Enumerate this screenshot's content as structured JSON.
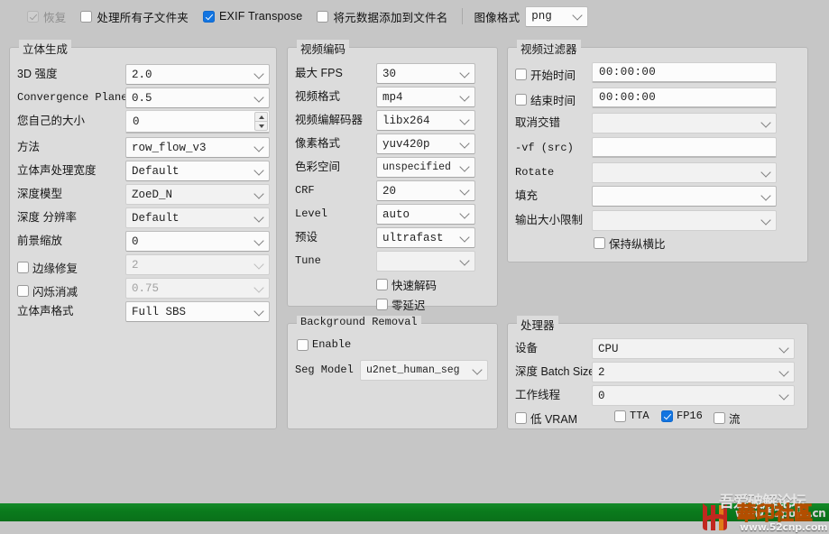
{
  "toolbar": {
    "restore": {
      "label": "恢复",
      "checked": true,
      "disabled": true
    },
    "process_subfolders": {
      "label": "处理所有子文件夹",
      "checked": false
    },
    "exif_transpose": {
      "label": "EXIF Transpose",
      "checked": true
    },
    "add_metadata_to_filename": {
      "label": "将元数据添加到文件名",
      "checked": false
    },
    "image_format_label": "图像格式",
    "image_format_value": "png"
  },
  "stereo_generation": {
    "title": "立体生成",
    "rows": [
      {
        "label": "3D 强度",
        "value": "2.0",
        "type": "combo"
      },
      {
        "label": "Convergence Plane",
        "value": "0.5",
        "type": "combo"
      },
      {
        "label": "您自己的大小",
        "value": "0",
        "type": "spin"
      },
      {
        "label": "方法",
        "value": "row_flow_v3",
        "type": "combo"
      },
      {
        "label": "立体声处理宽度",
        "value": "Default",
        "type": "combo"
      },
      {
        "label": "深度模型",
        "value": "ZoeD_N",
        "type": "combo"
      },
      {
        "label": "深度 分辨率",
        "value": "Default",
        "type": "combo"
      },
      {
        "label": "前景缩放",
        "value": "0",
        "type": "combo"
      },
      {
        "label": "边缘修复",
        "value": "2",
        "type": "combo-check",
        "checked": false,
        "disabled": true
      },
      {
        "label": "闪烁消减",
        "value": "0.75",
        "type": "combo-check",
        "checked": false,
        "disabled": true
      },
      {
        "label": "立体声格式",
        "value": "Full SBS",
        "type": "combo"
      }
    ]
  },
  "video_encoding": {
    "title": "视频编码",
    "rows": [
      {
        "label": "最大 FPS",
        "value": "30"
      },
      {
        "label": "视频格式",
        "value": "mp4"
      },
      {
        "label": "视频编解码器",
        "value": "libx264"
      },
      {
        "label": "像素格式",
        "value": "yuv420p"
      },
      {
        "label": "色彩空间",
        "value": "unspecified"
      },
      {
        "label": "CRF",
        "value": "20"
      },
      {
        "label": "Level",
        "value": "auto"
      },
      {
        "label": "预设",
        "value": "ultrafast"
      },
      {
        "label": "Tune",
        "value": ""
      }
    ],
    "checkboxes": [
      {
        "label": "快速解码",
        "checked": false
      },
      {
        "label": "零延迟",
        "checked": false
      }
    ]
  },
  "video_filter": {
    "title": "视频过滤器",
    "start_time": {
      "label": "开始时间",
      "value": "00:00:00",
      "checked": false
    },
    "end_time": {
      "label": "结束时间",
      "value": "00:00:00",
      "checked": false
    },
    "rows": [
      {
        "label": "取消交错",
        "value": "",
        "type": "combo"
      },
      {
        "label": "-vf (src)",
        "value": "",
        "type": "field"
      },
      {
        "label": "Rotate",
        "value": "",
        "type": "combo"
      },
      {
        "label": "填充",
        "value": "",
        "type": "combo"
      },
      {
        "label": "输出大小限制",
        "value": "",
        "type": "combo"
      }
    ],
    "keep_aspect": {
      "label": "保持纵横比",
      "checked": false
    }
  },
  "background_removal": {
    "title": "Background Removal",
    "enable": {
      "label": "Enable",
      "checked": false
    },
    "seg_model_label": "Seg Model",
    "seg_model_value": "u2net_human_seg"
  },
  "processor": {
    "title": "处理器",
    "rows": [
      {
        "label": "设备",
        "value": "CPU"
      },
      {
        "label": "深度 Batch Size",
        "value": "2"
      },
      {
        "label": "工作线程",
        "value": "0"
      }
    ],
    "checkboxes": [
      {
        "label": "低 VRAM",
        "checked": false
      },
      {
        "label": "TTA",
        "checked": false
      },
      {
        "label": "FP16",
        "checked": true
      },
      {
        "label": "流",
        "checked": false
      }
    ]
  },
  "progress": {
    "percent": 100
  },
  "watermark": {
    "site_cn": "吾爱破解论坛",
    "site_url": "www.52pojie.cn",
    "site_cn2": "華印社區",
    "site_url2": "www.52cnp.com"
  },
  "colors": {
    "background": "#c6c6c6",
    "panel": "#dcdcdc",
    "accent_checkbox": "#1274e0",
    "progress_green": "#0b7a1d",
    "watermark_orange": "#f08a1e"
  }
}
